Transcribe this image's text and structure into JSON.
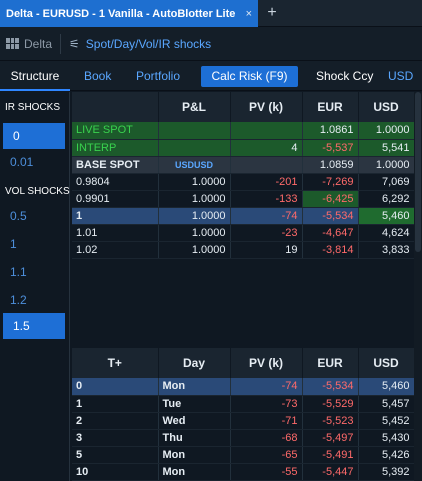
{
  "tab": {
    "title": "Delta - EURUSD - 1 Vanilla - AutoBlotter Lite",
    "close": "×",
    "new": "+"
  },
  "toolbar": {
    "delta": "Delta",
    "shocks": "Spot/Day/Vol/IR shocks"
  },
  "nav": {
    "structure": "Structure",
    "book": "Book",
    "portfolio": "Portfolio",
    "calc": "Calc Risk (F9)",
    "shock_ccy_label": "Shock Ccy",
    "shock_ccy": "USD"
  },
  "left": {
    "ir_head": "IR SHOCKS",
    "ir": [
      "0",
      "0.01"
    ],
    "vol_head": "VOL SHOCKS",
    "vol": [
      "0.5",
      "1",
      "1.1",
      "1.2",
      "1.5"
    ]
  },
  "structure": {
    "headers": [
      "",
      "P&L",
      "PV (k)",
      "EUR",
      "USD"
    ],
    "rows": [
      {
        "label": "LIVE SPOT",
        "pnl": "",
        "pv": "",
        "eur": "1.0861",
        "usd": "1.0000",
        "style": "green"
      },
      {
        "label": "INTERP",
        "pnl": "",
        "pv": "4",
        "eur": "-5,537",
        "usd": "5,541",
        "style": "green"
      },
      {
        "label": "BASE SPOT",
        "pnl": "USDUSD",
        "pv": "",
        "eur": "1.0859",
        "usd": "1.0000",
        "style": "base"
      },
      {
        "label": "0.9804",
        "pnl": "1.0000",
        "pv": "-201",
        "eur": "-7,269",
        "usd": "7,069",
        "style": ""
      },
      {
        "label": "0.9901",
        "pnl": "1.0000",
        "pv": "-133",
        "eur": "-6,425",
        "usd": "6,292",
        "style": "geur"
      },
      {
        "label": "1",
        "pnl": "1.0000",
        "pv": "-74",
        "eur": "-5,534",
        "usd": "5,460",
        "style": "sel"
      },
      {
        "label": "1.01",
        "pnl": "1.0000",
        "pv": "-23",
        "eur": "-4,647",
        "usd": "4,624",
        "style": ""
      },
      {
        "label": "1.02",
        "pnl": "1.0000",
        "pv": "19",
        "eur": "-3,814",
        "usd": "3,833",
        "style": ""
      }
    ]
  },
  "ladder": {
    "headers": [
      "T+",
      "Day",
      "PV (k)",
      "EUR",
      "USD"
    ],
    "rows": [
      {
        "t": "0",
        "day": "Mon",
        "pv": "-74",
        "eur": "-5,534",
        "usd": "5,460",
        "style": "sel"
      },
      {
        "t": "1",
        "day": "Tue",
        "pv": "-73",
        "eur": "-5,529",
        "usd": "5,457",
        "style": ""
      },
      {
        "t": "2",
        "day": "Wed",
        "pv": "-71",
        "eur": "-5,523",
        "usd": "5,452",
        "style": ""
      },
      {
        "t": "3",
        "day": "Thu",
        "pv": "-68",
        "eur": "-5,497",
        "usd": "5,430",
        "style": ""
      },
      {
        "t": "5",
        "day": "Mon",
        "pv": "-65",
        "eur": "-5,491",
        "usd": "5,426",
        "style": ""
      },
      {
        "t": "10",
        "day": "Mon",
        "pv": "-55",
        "eur": "-5,447",
        "usd": "5,392",
        "style": ""
      }
    ]
  },
  "colors": {
    "accent": "#1e6fd6",
    "negative": "#ff6a6a",
    "green_row": "#1c5a2b",
    "link": "#5aa7ff"
  }
}
